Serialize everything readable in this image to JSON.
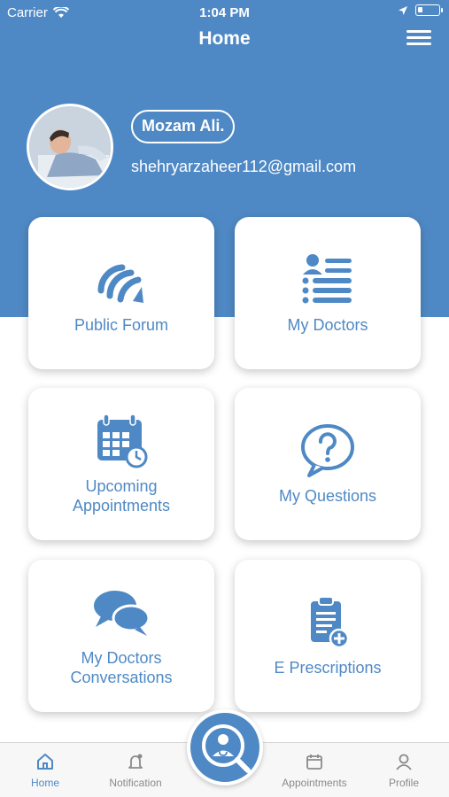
{
  "status_bar": {
    "carrier": "Carrier",
    "time": "1:04 PM"
  },
  "header": {
    "title": "Home"
  },
  "profile": {
    "name": "Mozam Ali.",
    "email": "shehryarzaheer112@gmail.com"
  },
  "tiles": [
    {
      "label": "Public Forum",
      "icon": "forum-icon"
    },
    {
      "label": "My Doctors",
      "icon": "doctors-list-icon"
    },
    {
      "label": "Upcoming Appointments",
      "icon": "calendar-clock-icon"
    },
    {
      "label": "My Questions",
      "icon": "question-bubble-icon"
    },
    {
      "label": "My Doctors Conversations",
      "icon": "chat-bubbles-icon"
    },
    {
      "label": "E Prescriptions",
      "icon": "prescription-clipboard-icon"
    }
  ],
  "tabbar": {
    "items": [
      {
        "label": "Home",
        "icon": "home-icon",
        "active": true
      },
      {
        "label": "Notification",
        "icon": "bell-icon"
      },
      {
        "label": "Appointments",
        "icon": "calendar-icon"
      },
      {
        "label": "Profile",
        "icon": "user-icon"
      }
    ],
    "center_icon": "doctor-search-icon"
  },
  "colors": {
    "primary": "#4f89c5",
    "tab_inactive": "#8a8a8a",
    "background": "#ffffff"
  }
}
